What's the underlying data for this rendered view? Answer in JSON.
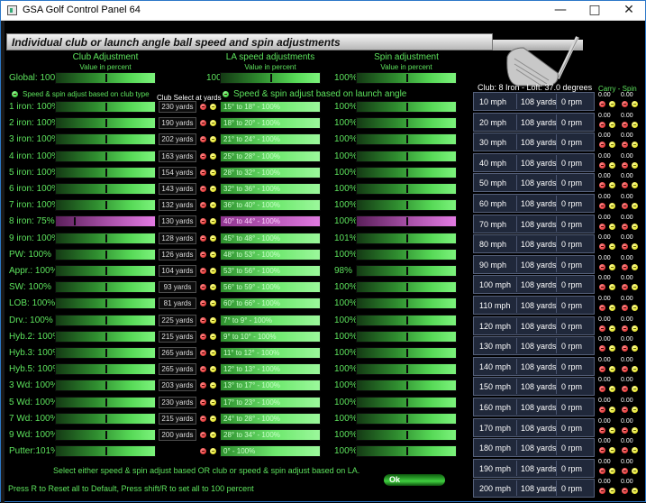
{
  "window": {
    "title": "GSA Golf Control Panel 64",
    "min_icon": "minimize-icon",
    "max_icon": "maximize-icon",
    "close_icon": "close-icon"
  },
  "header": {
    "title": "Individual club or launch angle ball speed and spin adjustments"
  },
  "columns": {
    "club": {
      "title": "Club Adjustment",
      "sub": "Value in percent"
    },
    "la": {
      "title": "LA speed adjustments",
      "sub": "Value in percent"
    },
    "spin": {
      "title": "Spin adjustment",
      "sub": "Value in percent"
    }
  },
  "global": {
    "label": "Global: 100%",
    "club_pct": "100",
    "spin_pct": "100%"
  },
  "options": {
    "club_type": "Speed & spin adjust based on club type",
    "club_select": "Club Select at yards",
    "launch_angle": "Speed & spin adjust based on launch angle"
  },
  "clubs": [
    {
      "label": "1 iron: 100%",
      "yards": "230 yards",
      "la": "15° to 18° - 100%",
      "spin": "100%",
      "sel": false
    },
    {
      "label": "2 iron: 100%",
      "yards": "190 yards",
      "la": "18° to 20° - 100%",
      "spin": "100%",
      "sel": false
    },
    {
      "label": "3 iron: 100%",
      "yards": "202 yards",
      "la": "21° to 24° - 100%",
      "spin": "100%",
      "sel": false
    },
    {
      "label": "4 iron: 100%",
      "yards": "163 yards",
      "la": "25° to 28° - 100%",
      "spin": "100%",
      "sel": false
    },
    {
      "label": "5 iron: 100%",
      "yards": "154 yards",
      "la": "28° to 32° - 100%",
      "spin": "100%",
      "sel": false
    },
    {
      "label": "6 iron: 100%",
      "yards": "143 yards",
      "la": "32° to 36° - 100%",
      "spin": "100%",
      "sel": false
    },
    {
      "label": "7 iron: 100%",
      "yards": "132 yards",
      "la": "36° to 40° - 100%",
      "spin": "100%",
      "sel": false
    },
    {
      "label": "8 iron: 75%",
      "yards": "130 yards",
      "la": "40° to 44° - 100%",
      "spin": "100%",
      "sel": true
    },
    {
      "label": "9 iron: 100%",
      "yards": "128 yards",
      "la": "45° to 48° - 100%",
      "spin": "101%",
      "sel": false
    },
    {
      "label": "PW: 100%",
      "yards": "126 yards",
      "la": "48° to 53° - 100%",
      "spin": "100%",
      "sel": false
    },
    {
      "label": "Appr.: 100%",
      "yards": "104 yards",
      "la": "53° to 56° - 100%",
      "spin": "98%",
      "sel": false
    },
    {
      "label": "SW: 100%",
      "yards": "93 yards",
      "la": "56° to 59° - 100%",
      "spin": "100%",
      "sel": false
    },
    {
      "label": "LOB: 100%",
      "yards": "81 yards",
      "la": "60° to 66° - 100%",
      "spin": "100%",
      "sel": false
    },
    {
      "label": "Drv.: 100%",
      "yards": "225 yards",
      "la": "7° to 9° - 100%",
      "spin": "100%",
      "sel": false
    },
    {
      "label": "Hyb.2: 100%",
      "yards": "215 yards",
      "la": "9° to 10° - 100%",
      "spin": "100%",
      "sel": false
    },
    {
      "label": "Hyb.3: 100%",
      "yards": "265 yards",
      "la": "11° to 12° - 100%",
      "spin": "100%",
      "sel": false
    },
    {
      "label": "Hyb.5: 100%",
      "yards": "265 yards",
      "la": "12° to 13° - 100%",
      "spin": "100%",
      "sel": false
    },
    {
      "label": "3 Wd: 100%",
      "yards": "203 yards",
      "la": "13° to 17° - 100%",
      "spin": "100%",
      "sel": false
    },
    {
      "label": "5 Wd: 100%",
      "yards": "230 yards",
      "la": "17° to 23° - 100%",
      "spin": "100%",
      "sel": false
    },
    {
      "label": "7 Wd: 100%",
      "yards": "215 yards",
      "la": "24° to 28° - 100%",
      "spin": "100%",
      "sel": false
    },
    {
      "label": "9 Wd: 100%",
      "yards": "200 yards",
      "la": "28° to 34° - 100%",
      "spin": "100%",
      "sel": false
    },
    {
      "label": "Putter:101%",
      "yards": "",
      "la": "0° - 100%",
      "spin": "100%",
      "sel": false
    }
  ],
  "club_info": "Club: 8 Iron - Loft: 37.0 degrees",
  "carry_spin": "Carry - Spin",
  "speeds": [
    {
      "mph": "10 mph",
      "yards": "108 yards",
      "rpm": "0 rpm",
      "carry": "0.00",
      "spin": "0.00"
    },
    {
      "mph": "20 mph",
      "yards": "108 yards",
      "rpm": "0 rpm",
      "carry": "0.00",
      "spin": "0.00"
    },
    {
      "mph": "30 mph",
      "yards": "108 yards",
      "rpm": "0 rpm",
      "carry": "0.00",
      "spin": "0.00"
    },
    {
      "mph": "40 mph",
      "yards": "108 yards",
      "rpm": "0 rpm",
      "carry": "0.00",
      "spin": "0.00"
    },
    {
      "mph": "50 mph",
      "yards": "108 yards",
      "rpm": "0 rpm",
      "carry": "0.00",
      "spin": "0.00"
    },
    {
      "mph": "60 mph",
      "yards": "108 yards",
      "rpm": "0 rpm",
      "carry": "0.00",
      "spin": "0.00"
    },
    {
      "mph": "70 mph",
      "yards": "108 yards",
      "rpm": "0 rpm",
      "carry": "0.00",
      "spin": "0.00"
    },
    {
      "mph": "80 mph",
      "yards": "108 yards",
      "rpm": "0 rpm",
      "carry": "0.00",
      "spin": "0.00"
    },
    {
      "mph": "90 mph",
      "yards": "108 yards",
      "rpm": "0 rpm",
      "carry": "0.00",
      "spin": "0.00"
    },
    {
      "mph": "100 mph",
      "yards": "108 yards",
      "rpm": "0 rpm",
      "carry": "0.00",
      "spin": "0.00"
    },
    {
      "mph": "110 mph",
      "yards": "108 yards",
      "rpm": "0 rpm",
      "carry": "0.00",
      "spin": "0.00"
    },
    {
      "mph": "120 mph",
      "yards": "108 yards",
      "rpm": "0 rpm",
      "carry": "0.00",
      "spin": "0.00"
    },
    {
      "mph": "130 mph",
      "yards": "108 yards",
      "rpm": "0 rpm",
      "carry": "0.00",
      "spin": "0.00"
    },
    {
      "mph": "140 mph",
      "yards": "108 yards",
      "rpm": "0 rpm",
      "carry": "0.00",
      "spin": "0.00"
    },
    {
      "mph": "150 mph",
      "yards": "108 yards",
      "rpm": "0 rpm",
      "carry": "0.00",
      "spin": "0.00"
    },
    {
      "mph": "160 mph",
      "yards": "108 yards",
      "rpm": "0 rpm",
      "carry": "0.00",
      "spin": "0.00"
    },
    {
      "mph": "170 mph",
      "yards": "108 yards",
      "rpm": "0 rpm",
      "carry": "0.00",
      "spin": "0.00"
    },
    {
      "mph": "180 mph",
      "yards": "108 yards",
      "rpm": "0 rpm",
      "carry": "0.00",
      "spin": "0.00"
    },
    {
      "mph": "190 mph",
      "yards": "108 yards",
      "rpm": "0 rpm",
      "carry": "0.00",
      "spin": "0.00"
    },
    {
      "mph": "200 mph",
      "yards": "108 yards",
      "rpm": "0 rpm",
      "carry": "0.00",
      "spin": "0.00"
    }
  ],
  "footer": {
    "instruction": "Select either speed & spin adjust based OR club or speed & spin adjust based on LA.",
    "reset": "Press R to Reset all to Default, Press shift/R to set all to 100 percent",
    "ok": "Ok"
  },
  "colors": {
    "accent_green": "#5de35d",
    "selected_row": "#e27ae2",
    "panel_bg": "#20283a"
  }
}
